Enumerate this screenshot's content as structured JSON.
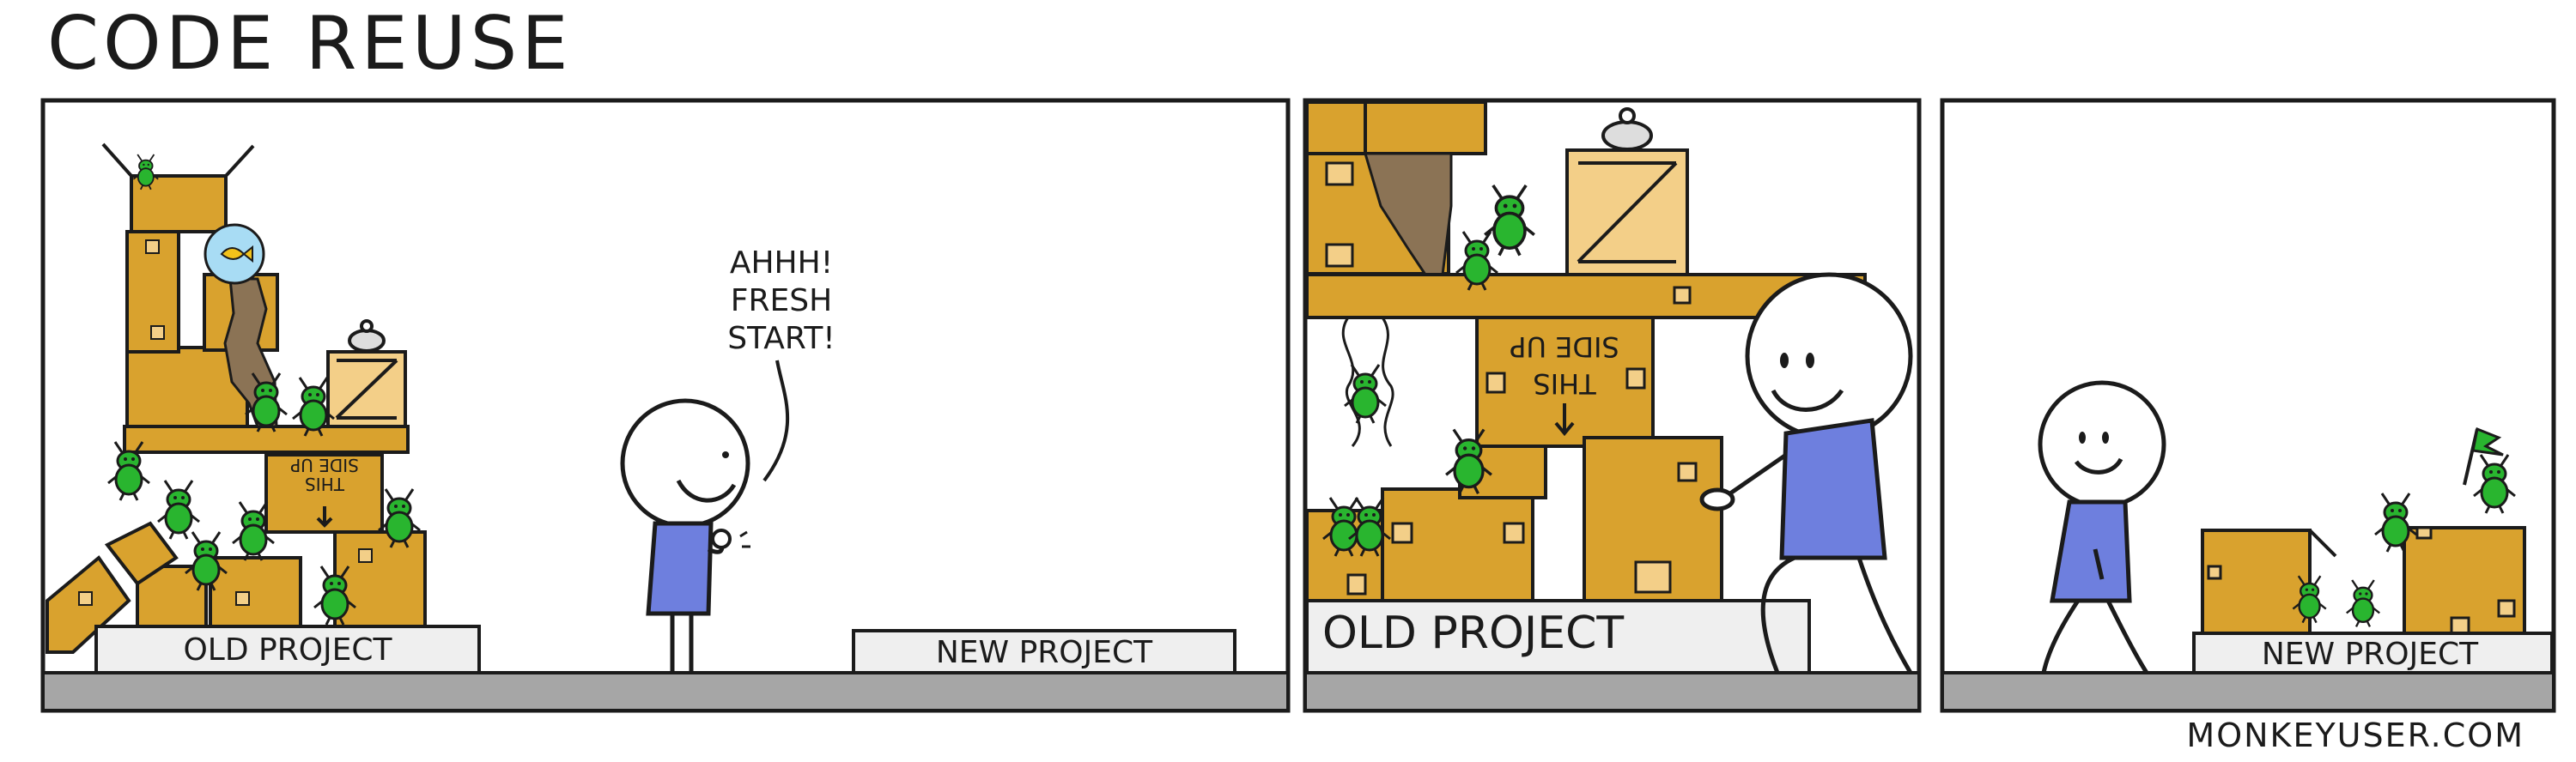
{
  "title": "CODE REUSE",
  "credit": "MONKEYUSER.COM",
  "panels": [
    {
      "signs": {
        "old_project": "OLD PROJECT",
        "new_project": "NEW PROJECT"
      },
      "speech": [
        "AHHH!",
        "FRESH",
        "START!"
      ],
      "box_text": [
        "THIS",
        "SIDE UP"
      ]
    },
    {
      "signs": {
        "old_project": "OLD PROJECT"
      },
      "box_text": [
        "THIS",
        "SIDE UP"
      ]
    },
    {
      "signs": {
        "new_project": "NEW PROJECT"
      }
    }
  ],
  "colors": {
    "box": "#d9a22e",
    "box_light": "#f3cf88",
    "bug": "#29b52f",
    "shirt": "#6e7fde",
    "sign": "#efefef",
    "floor": "#a6a6a6",
    "outline": "#1b1b1b",
    "mold": "#8b7355",
    "fishbowl": "#a8dcf4",
    "fish": "#f2c21a"
  }
}
